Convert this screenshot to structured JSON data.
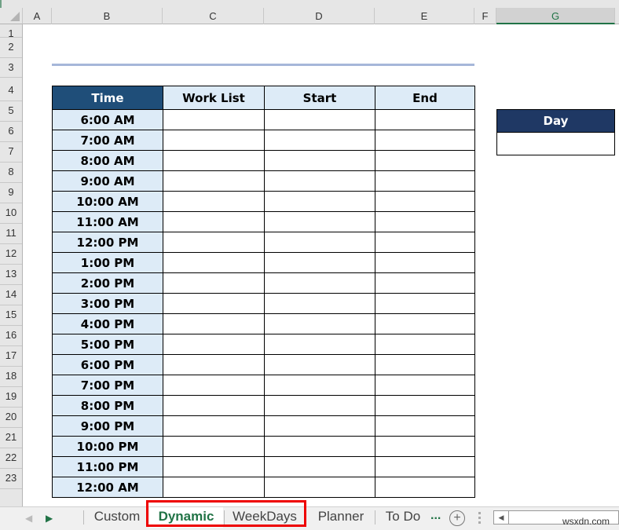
{
  "columns": [
    "A",
    "B",
    "C",
    "D",
    "E",
    "F",
    "G"
  ],
  "rows": [
    "1",
    "2",
    "3",
    "4",
    "5",
    "6",
    "7",
    "8",
    "9",
    "10",
    "11",
    "12",
    "13",
    "14",
    "15",
    "16",
    "17",
    "18",
    "19",
    "20",
    "21",
    "22",
    "23"
  ],
  "schedule": {
    "headers": [
      "Time",
      "Work List",
      "Start",
      "End"
    ],
    "times": [
      "6:00 AM",
      "7:00 AM",
      "8:00 AM",
      "9:00 AM",
      "10:00 AM",
      "11:00 AM",
      "12:00 PM",
      "1:00 PM",
      "2:00 PM",
      "3:00 PM",
      "4:00 PM",
      "5:00 PM",
      "6:00 PM",
      "7:00 PM",
      "8:00 PM",
      "9:00 PM",
      "10:00 PM",
      "11:00 PM",
      "12:00 AM"
    ]
  },
  "day_box": {
    "header": "Day",
    "value": ""
  },
  "sheet_tabs": [
    "Custom",
    "Dynamic",
    "WeekDays",
    "Planner",
    "To Do"
  ],
  "active_tab": "Dynamic",
  "more_tabs": "...",
  "add_sheet": "+",
  "watermark": "wsxdn.com",
  "colors": {
    "accent": "#217346",
    "header_dark": "#1f4e79",
    "header_light": "#ddebf7",
    "highlight": "#e00000"
  }
}
